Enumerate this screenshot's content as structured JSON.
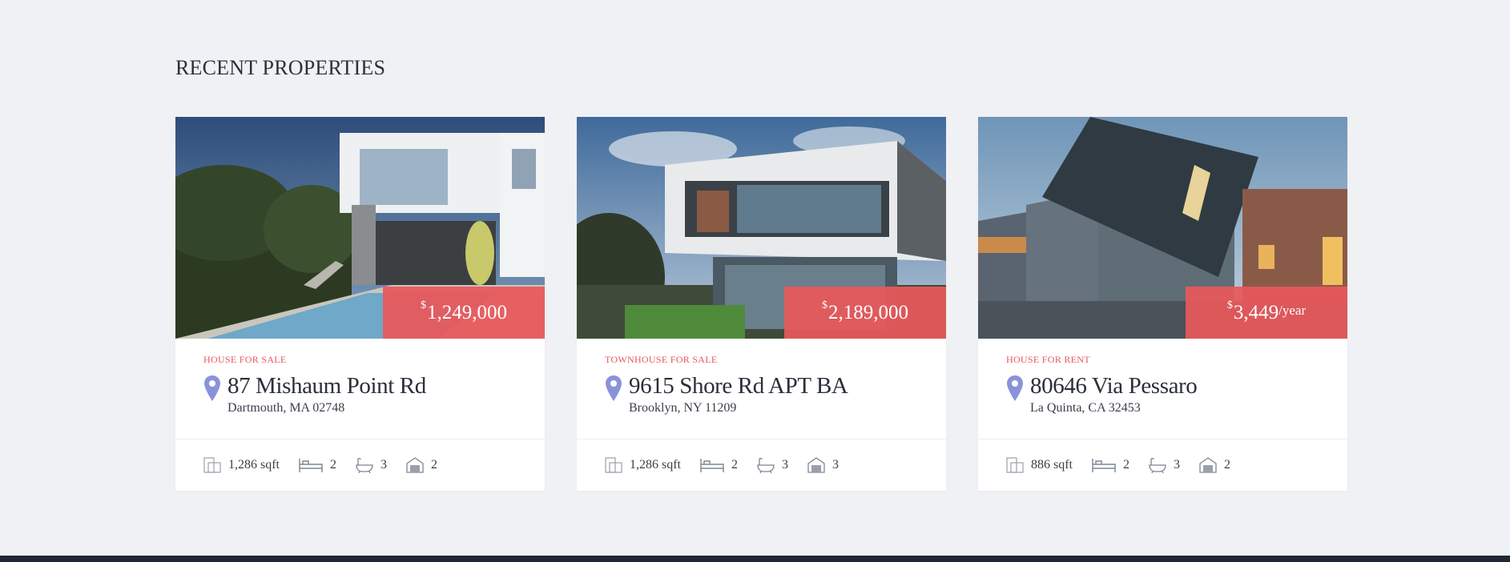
{
  "section": {
    "title": "RECENT PROPERTIES"
  },
  "colors": {
    "accent": "#e8585a",
    "pin": "#8b93d8",
    "background": "#f0f1f4"
  },
  "properties": [
    {
      "price_currency": "$",
      "price_amount": "1,249,000",
      "price_period": "",
      "kind": "HOUSE FOR SALE",
      "address": "87 Mishaum Point Rd",
      "city": "Dartmouth, MA 02748",
      "area": "1,286 sqft",
      "beds": "2",
      "baths": "3",
      "garages": "2",
      "photo": "modern-white-house-with-pool"
    },
    {
      "price_currency": "$",
      "price_amount": "2,189,000",
      "price_period": "",
      "kind": "TOWNHOUSE FOR SALE",
      "address": "9615 Shore Rd APT BA",
      "city": "Brooklyn, NY 11209",
      "area": "1,286 sqft",
      "beds": "2",
      "baths": "3",
      "garages": "3",
      "photo": "modern-box-house-glass"
    },
    {
      "price_currency": "$",
      "price_amount": "3,449",
      "price_period": "/year",
      "kind": "HOUSE FOR RENT",
      "address": "80646 Via Pessaro",
      "city": "La Quinta, CA 32453",
      "area": "886 sqft",
      "beds": "2",
      "baths": "3",
      "garages": "2",
      "photo": "dark-angled-roof-house"
    }
  ]
}
